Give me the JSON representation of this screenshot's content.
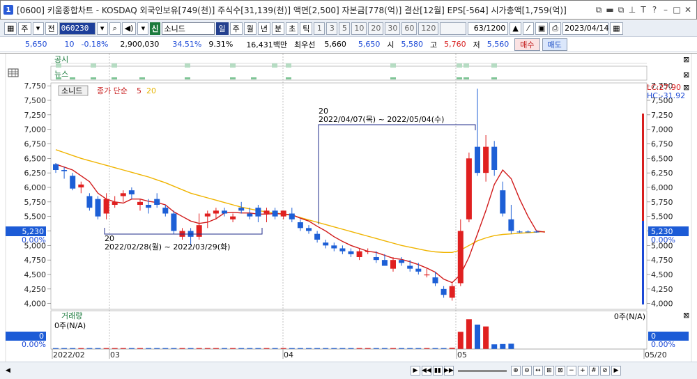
{
  "window": {
    "badge": "1",
    "title": "[0600] 키움종합차트 - KOSDAQ 외국인보유[749(천)] 주식수[31,139(천)] 액면[2,500] 자본금[778(억)] 결산[12월] EPS[-564] 시가총액[1,759(억)]"
  },
  "toolbar": {
    "market_toggle": "주",
    "menu_label": "전",
    "stock_code": "060230",
    "sin_badge": "신",
    "stock_name": "소니드",
    "periods": [
      "일",
      "주",
      "월",
      "년",
      "분",
      "초",
      "틱"
    ],
    "intervals": [
      "1",
      "3",
      "5",
      "10",
      "20",
      "30",
      "60",
      "120"
    ],
    "count": "63/1200",
    "date": "2023/04/14"
  },
  "quote": {
    "price": "5,650",
    "change": "10",
    "change_pct": "-0.18%",
    "volume": "2,900,030",
    "turnover_pct": "34.51%",
    "ratio_pct": "9.31%",
    "trade_value": "16,431백만",
    "best_label": "최우선",
    "best_ask": "5,660",
    "best_bid": "5,650",
    "open_label": "시",
    "open": "5,580",
    "high_label": "고",
    "high": "5,760",
    "low_label": "저",
    "low": "5,560",
    "buy_label": "매수",
    "sell_label": "매도"
  },
  "panes": {
    "notice_label": "공시",
    "news_label": "뉴스",
    "volume_title": "거래량",
    "volume_left": "0주(N/A)",
    "volume_right": "0주(N/A)",
    "volume_axis_value": "0",
    "volume_axis_pct": "0.00%"
  },
  "chart_data": {
    "type": "candlestick",
    "legend_name": "소니드",
    "ma_label": "종가 단순",
    "ma_short": "5",
    "ma_long": "20",
    "ylim": [
      3900,
      7800
    ],
    "y_ticks": [
      "7,750",
      "7,500",
      "7,250",
      "7,000",
      "6,750",
      "6,500",
      "6,250",
      "6,000",
      "5,750",
      "5,500",
      "5,250",
      "5,000",
      "4,750",
      "4,500",
      "4,250",
      "4,000"
    ],
    "right_labels": {
      "lc": "LC:27.90",
      "hc": "HC:-31.92",
      "current": "5,230",
      "current_pct": "0.00%"
    },
    "x_labels": [
      "2022/02",
      "03",
      "04",
      "05",
      "05/20"
    ],
    "annotations": [
      {
        "count": "20",
        "range": "2022/04/07(목) ~ 2022/05/04(수)"
      },
      {
        "count": "20",
        "range": "2022/02/28(월) ~ 2022/03/29(화)"
      }
    ],
    "candles": [
      {
        "o": 6400,
        "h": 6420,
        "l": 6250,
        "c": 6300
      },
      {
        "o": 6300,
        "h": 6350,
        "l": 6150,
        "c": 6280
      },
      {
        "o": 6200,
        "h": 6250,
        "l": 5950,
        "c": 5980
      },
      {
        "o": 6000,
        "h": 6100,
        "l": 5900,
        "c": 6050
      },
      {
        "o": 5850,
        "h": 5900,
        "l": 5600,
        "c": 5650
      },
      {
        "o": 5800,
        "h": 5850,
        "l": 5450,
        "c": 5500
      },
      {
        "o": 5550,
        "h": 5900,
        "l": 5450,
        "c": 5800
      },
      {
        "o": 5700,
        "h": 5850,
        "l": 5650,
        "c": 5750
      },
      {
        "o": 5850,
        "h": 5950,
        "l": 5750,
        "c": 5900
      },
      {
        "o": 5950,
        "h": 6000,
        "l": 5800,
        "c": 5880
      },
      {
        "o": 5700,
        "h": 5800,
        "l": 5600,
        "c": 5750
      },
      {
        "o": 5700,
        "h": 5800,
        "l": 5550,
        "c": 5650
      },
      {
        "o": 5800,
        "h": 5900,
        "l": 5650,
        "c": 5700
      },
      {
        "o": 5650,
        "h": 5700,
        "l": 5500,
        "c": 5550
      },
      {
        "o": 5550,
        "h": 5600,
        "l": 5200,
        "c": 5250
      },
      {
        "o": 5150,
        "h": 5300,
        "l": 5100,
        "c": 5250
      },
      {
        "o": 5250,
        "h": 5300,
        "l": 5000,
        "c": 5150
      },
      {
        "o": 5150,
        "h": 5550,
        "l": 5100,
        "c": 5350
      },
      {
        "o": 5500,
        "h": 5600,
        "l": 5300,
        "c": 5550
      },
      {
        "o": 5550,
        "h": 5650,
        "l": 5450,
        "c": 5600
      },
      {
        "o": 5600,
        "h": 5650,
        "l": 5500,
        "c": 5550
      },
      {
        "o": 5450,
        "h": 5550,
        "l": 5400,
        "c": 5500
      },
      {
        "o": 5650,
        "h": 5750,
        "l": 5550,
        "c": 5600
      },
      {
        "o": 5550,
        "h": 5650,
        "l": 5450,
        "c": 5500
      },
      {
        "o": 5650,
        "h": 5700,
        "l": 5400,
        "c": 5500
      },
      {
        "o": 5550,
        "h": 5650,
        "l": 5400,
        "c": 5600
      },
      {
        "o": 5600,
        "h": 5650,
        "l": 5450,
        "c": 5500
      },
      {
        "o": 5500,
        "h": 5550,
        "l": 5450,
        "c": 5600
      },
      {
        "o": 5550,
        "h": 5650,
        "l": 5400,
        "c": 5450
      },
      {
        "o": 5400,
        "h": 5450,
        "l": 5250,
        "c": 5300
      },
      {
        "o": 5300,
        "h": 5350,
        "l": 5200,
        "c": 5250
      },
      {
        "o": 5200,
        "h": 5250,
        "l": 5050,
        "c": 5100
      },
      {
        "o": 5050,
        "h": 5100,
        "l": 4950,
        "c": 5000
      },
      {
        "o": 5000,
        "h": 5050,
        "l": 4900,
        "c": 4950
      },
      {
        "o": 4950,
        "h": 5000,
        "l": 4850,
        "c": 4900
      },
      {
        "o": 4900,
        "h": 4950,
        "l": 4800,
        "c": 4850
      },
      {
        "o": 4800,
        "h": 4950,
        "l": 4750,
        "c": 4900
      },
      {
        "o": 4900,
        "h": 4950,
        "l": 4850,
        "c": 4900
      },
      {
        "o": 4800,
        "h": 4900,
        "l": 4700,
        "c": 4750
      },
      {
        "o": 4750,
        "h": 4850,
        "l": 4650,
        "c": 4650
      },
      {
        "o": 4600,
        "h": 4800,
        "l": 4550,
        "c": 4750
      },
      {
        "o": 4750,
        "h": 4800,
        "l": 4650,
        "c": 4700
      },
      {
        "o": 4650,
        "h": 4750,
        "l": 4550,
        "c": 4600
      },
      {
        "o": 4600,
        "h": 4700,
        "l": 4500,
        "c": 4550
      },
      {
        "o": 4500,
        "h": 4600,
        "l": 4450,
        "c": 4500
      },
      {
        "o": 4450,
        "h": 4550,
        "l": 4300,
        "c": 4350
      },
      {
        "o": 4250,
        "h": 4300,
        "l": 4100,
        "c": 4150
      },
      {
        "o": 4100,
        "h": 4350,
        "l": 4050,
        "c": 4300
      },
      {
        "o": 4350,
        "h": 5450,
        "l": 4300,
        "c": 5250
      },
      {
        "o": 5450,
        "h": 6600,
        "l": 5400,
        "c": 6500
      },
      {
        "o": 6700,
        "h": 7700,
        "l": 6200,
        "c": 6250
      },
      {
        "o": 6250,
        "h": 6900,
        "l": 6100,
        "c": 6700
      },
      {
        "o": 6700,
        "h": 6800,
        "l": 6200,
        "c": 6300
      },
      {
        "o": 5950,
        "h": 6100,
        "l": 5500,
        "c": 5550
      },
      {
        "o": 5450,
        "h": 5700,
        "l": 5200,
        "c": 5250
      },
      {
        "o": 5240,
        "h": 5260,
        "l": 5220,
        "c": 5230
      },
      {
        "o": 5240,
        "h": 5260,
        "l": 5220,
        "c": 5230
      },
      {
        "o": 5240,
        "h": 5260,
        "l": 5220,
        "c": 5230
      }
    ],
    "ma5": [
      6400,
      6350,
      6300,
      6200,
      6100,
      5900,
      5800,
      5750,
      5730,
      5800,
      5800,
      5760,
      5740,
      5700,
      5580,
      5500,
      5420,
      5380,
      5400,
      5460,
      5560,
      5570,
      5560,
      5560,
      5540,
      5540,
      5550,
      5540,
      5530,
      5470,
      5420,
      5330,
      5250,
      5150,
      5070,
      5000,
      4950,
      4900,
      4880,
      4830,
      4780,
      4760,
      4720,
      4670,
      4610,
      4540,
      4420,
      4360,
      4500,
      4800,
      5200,
      5600,
      6050,
      6300,
      6150,
      5800,
      5500,
      5250,
      5230
    ],
    "ma20": [
      6650,
      6600,
      6550,
      6500,
      6460,
      6420,
      6380,
      6340,
      6300,
      6260,
      6220,
      6180,
      6130,
      6080,
      6020,
      5960,
      5900,
      5860,
      5820,
      5780,
      5740,
      5700,
      5660,
      5630,
      5600,
      5580,
      5560,
      5540,
      5520,
      5480,
      5440,
      5400,
      5360,
      5320,
      5280,
      5240,
      5200,
      5160,
      5120,
      5080,
      5040,
      5000,
      4970,
      4940,
      4910,
      4890,
      4880,
      4880,
      4920,
      5000,
      5080,
      5130,
      5170,
      5190,
      5200,
      5210,
      5220,
      5230,
      5240
    ],
    "volume": [
      0.03,
      0.03,
      0.03,
      0.03,
      0.03,
      0.03,
      0.03,
      0.03,
      0.03,
      0.03,
      0.03,
      0.03,
      0.03,
      0.03,
      0.03,
      0.03,
      0.03,
      0.03,
      0.03,
      0.03,
      0.03,
      0.03,
      0.03,
      0.03,
      0.03,
      0.03,
      0.03,
      0.03,
      0.03,
      0.03,
      0.03,
      0.03,
      0.03,
      0.03,
      0.03,
      0.03,
      0.03,
      0.03,
      0.03,
      0.03,
      0.03,
      0.03,
      0.03,
      0.03,
      0.03,
      0.03,
      0.03,
      0.04,
      0.55,
      0.95,
      0.78,
      0.72,
      0.15,
      0.16,
      0.17,
      0,
      0,
      0
    ]
  }
}
